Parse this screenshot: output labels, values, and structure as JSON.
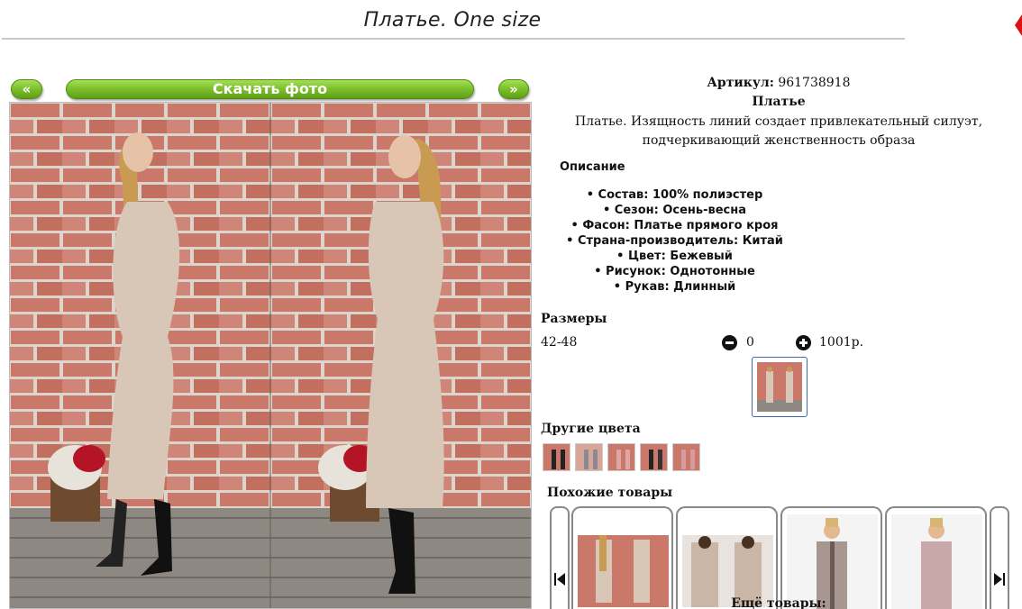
{
  "page": {
    "title": "Платье. One size"
  },
  "gallery": {
    "prev_label": "«",
    "download_label": "Скачать фото",
    "next_label": "»"
  },
  "product": {
    "article_label": "Артикул:",
    "article_value": "961738918",
    "name": "Платье",
    "description": "Платье. Изящность линий создает привлекательный силуэт, подчеркивающий женственность образа"
  },
  "description_section": {
    "title": "Описание",
    "specs": [
      "Состав: 100% полиэстер",
      "Сезон: Осень-весна",
      "Фасон: Платье прямого кроя",
      "Страна-производитель: Китай",
      "Цвет: Бежевый",
      "Рисунок: Однотонные",
      "Рукав: Длинный"
    ]
  },
  "sizes": {
    "title": "Размеры",
    "rows": [
      {
        "size": "42-48",
        "quantity": "0",
        "price": "1001р."
      }
    ]
  },
  "other_colors": {
    "title": "Другие цвета",
    "colors": [
      "black",
      "grey",
      "pink",
      "black",
      "pink"
    ]
  },
  "similar": {
    "title": "Похожие товары",
    "more_label": "Ещё товары:"
  },
  "icons": {
    "minus": "minus-circle-icon",
    "plus": "plus-circle-icon",
    "carousel_prev": "skip-back-icon",
    "carousel_next": "skip-forward-icon"
  },
  "colors": {
    "button_green": "#7ec22d",
    "brick": "#c9786a",
    "dress_beige": "#d8c6b6"
  }
}
